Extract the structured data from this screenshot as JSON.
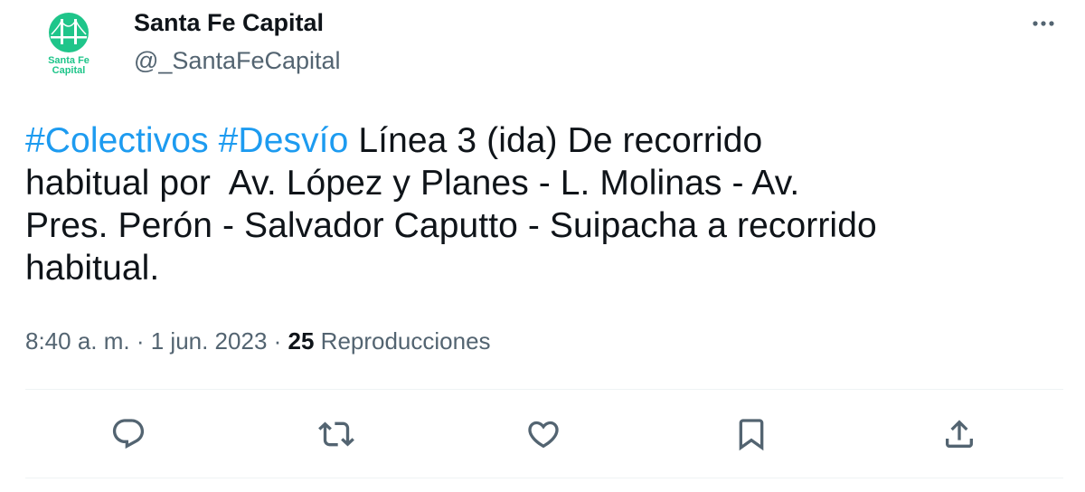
{
  "author": {
    "name": "Santa Fe Capital",
    "handle": "@_SantaFeCapital",
    "avatar_text_line1": "Santa Fe",
    "avatar_text_line2": "Capital",
    "avatar_color": "#1fc58a"
  },
  "tweet": {
    "lines": [
      [
        {
          "type": "hashtag",
          "text": "#Colectivos"
        },
        {
          "type": "text",
          "text": " "
        },
        {
          "type": "hashtag",
          "text": "#Desvío"
        },
        {
          "type": "text",
          "text": " Línea 3 (ida) De recorrido"
        }
      ],
      [
        {
          "type": "text",
          "text": "habitual por  Av. López y Planes - L. Molinas - Av."
        }
      ],
      [
        {
          "type": "text",
          "text": "Pres. Perón - Salvador Caputto - Suipacha a recorrido"
        }
      ],
      [
        {
          "type": "text",
          "text": "habitual."
        }
      ]
    ],
    "hashtag_color": "#1d9bf0"
  },
  "meta": {
    "time": "8:40 a. m.",
    "separator": " · ",
    "date": "1 jun. 2023",
    "views_count": "25",
    "views_label": " Reproducciones"
  },
  "actions": [
    {
      "name": "reply",
      "icon": "reply-icon"
    },
    {
      "name": "retweet",
      "icon": "retweet-icon"
    },
    {
      "name": "like",
      "icon": "like-icon"
    },
    {
      "name": "bookmark",
      "icon": "bookmark-icon"
    },
    {
      "name": "share",
      "icon": "share-icon"
    }
  ],
  "colors": {
    "text": "#0f1419",
    "secondary": "#536471",
    "divider": "#eff3f4"
  }
}
